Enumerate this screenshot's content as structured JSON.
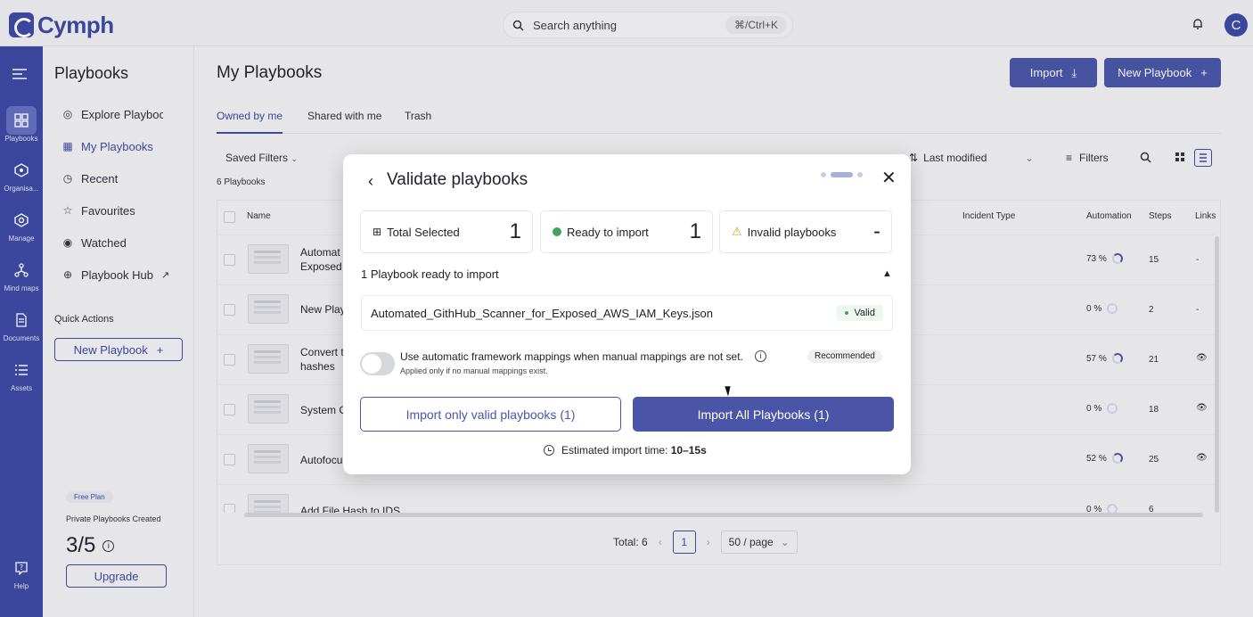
{
  "brand": "Cymph",
  "search": {
    "placeholder": "Search anything",
    "shortcut": "⌘/Ctrl+K"
  },
  "user_initial": "C",
  "rail": [
    {
      "label": "Playbooks",
      "icon": "playbooks-icon"
    },
    {
      "label": "Organisa...",
      "icon": "organisation-icon"
    },
    {
      "label": "Manage",
      "icon": "manage-icon"
    },
    {
      "label": "Mind maps",
      "icon": "mindmaps-icon"
    },
    {
      "label": "Documents",
      "icon": "documents-icon"
    },
    {
      "label": "Assets",
      "icon": "assets-icon"
    },
    {
      "label": "Help",
      "icon": "help-icon"
    }
  ],
  "sidebar": {
    "title": "Playbooks",
    "items": [
      {
        "label": "Explore Playbooks"
      },
      {
        "label": "My Playbooks"
      },
      {
        "label": "Recent"
      },
      {
        "label": "Favourites"
      },
      {
        "label": "Watched"
      },
      {
        "label": "Playbook Hub"
      }
    ],
    "quick_actions": "Quick Actions",
    "new_playbook": "New Playbook",
    "plan": "Free Plan",
    "private_created": "Private Playbooks Created",
    "usage": "3/5",
    "upgrade": "Upgrade"
  },
  "main": {
    "title": "My Playbooks",
    "import_label": "Import",
    "new_label": "New Playbook",
    "tabs": [
      "Owned by me",
      "Shared with me",
      "Trash"
    ],
    "saved_filters": "Saved Filters",
    "count": "6 Playbooks",
    "sort": "Last modified",
    "filters": "Filters",
    "columns": [
      "Name",
      "Incident Type",
      "Automation",
      "Steps",
      "Links"
    ],
    "rows": [
      {
        "name1": "Automat",
        "name2": "Exposed",
        "automation": "73 %",
        "steps": "15",
        "links": "-",
        "fill": 0.73
      },
      {
        "name1": "New Play",
        "name2": "",
        "automation": "0 %",
        "steps": "2",
        "links": "-",
        "fill": 0
      },
      {
        "name1": "Convert t",
        "name2": "hashes",
        "automation": "57 %",
        "steps": "21",
        "links": "",
        "fill": 0.57
      },
      {
        "name1": "System C",
        "name2": "",
        "automation": "0 %",
        "steps": "18",
        "links": "",
        "fill": 0
      },
      {
        "name1": "Autofocu",
        "name2": "",
        "automation": "52 %",
        "steps": "25",
        "links": "",
        "fill": 0.52
      },
      {
        "name1": "Add File Hash to IDS",
        "name2": "",
        "automation": "0 %",
        "steps": "6",
        "links": "",
        "fill": 0
      }
    ],
    "total": "Total: 6",
    "page": "1",
    "page_size": "50 / page"
  },
  "modal": {
    "title": "Validate playbooks",
    "stats": [
      {
        "label": "Total Selected",
        "value": "1"
      },
      {
        "label": "Ready to import",
        "value": "1"
      },
      {
        "label": "Invalid playbooks",
        "value": "-"
      }
    ],
    "ready_heading": "1 Playbook ready to import",
    "file_name": "Automated_GithHub_Scanner_for_Exposed_AWS_IAM_Keys.json",
    "valid_badge": "Valid",
    "option_title": "Use automatic framework mappings when manual mappings are not set.",
    "option_sub": "Applied only if no manual mappings exist.",
    "recommended": "Recommended",
    "btn_valid": "Import only valid playbooks (1)",
    "btn_all": "Import All Playbooks (1)",
    "estimate_prefix": "Estimated import time: ",
    "estimate_value": "10–15s"
  }
}
